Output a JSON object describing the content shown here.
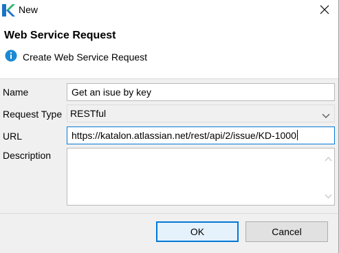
{
  "window": {
    "title": "New",
    "app_icon": "katalon-logo-icon",
    "close_icon": "close-icon"
  },
  "banner": {
    "title": "Web Service Request",
    "message": "Create Web Service Request",
    "icon": "info-icon"
  },
  "form": {
    "name_label": "Name",
    "name_value": "Get an isue by key",
    "request_type_label": "Request Type",
    "request_type_value": "RESTful",
    "url_label": "URL",
    "url_value": "https://katalon.atlassian.net/rest/api/2/issue/KD-1000",
    "description_label": "Description",
    "description_value": ""
  },
  "buttons": {
    "ok_label": "OK",
    "cancel_label": "Cancel"
  },
  "colors": {
    "accent": "#0078d7",
    "logo_green": "#2fb577",
    "logo_blue": "#1a73c9"
  }
}
